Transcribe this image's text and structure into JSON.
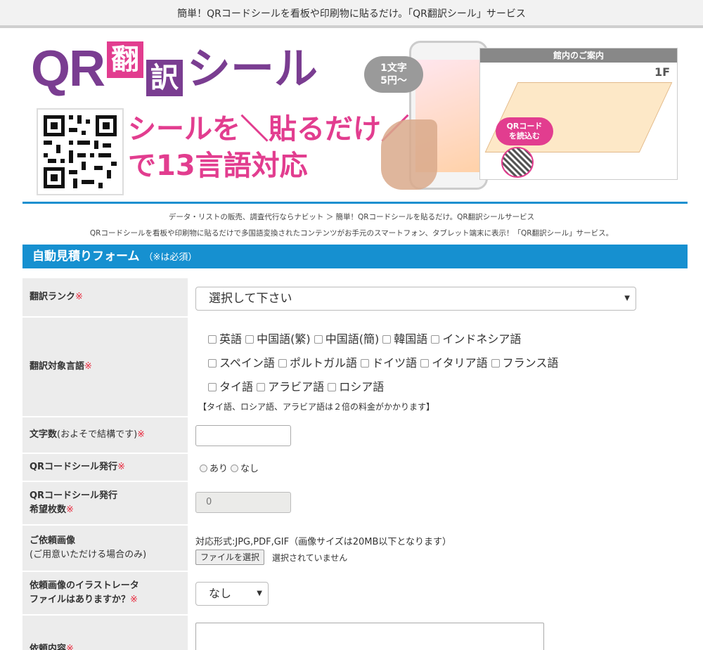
{
  "topbar": {
    "text": "簡単！QRコードシールを看板や印刷物に貼るだけ。「QR翻訳シール」サービス"
  },
  "banner": {
    "logo_qr": "QR",
    "logo_char1": "翻",
    "logo_char2": "訳",
    "logo_seal": "シール",
    "tagline_line1": "シールを＼貼るだけ／",
    "tagline_line2": "で13言語対応",
    "bubble_line1": "1文字",
    "bubble_line2": "5円～",
    "map_title": "館内のご案内",
    "map_floor": "1F",
    "map_badge_line1": "QRコード",
    "map_badge_line2": "を読込む"
  },
  "breadcrumb": "データ・リストの販売、調査代行ならナビット ＞ 簡単！QRコードシールを貼るだけ。QR翻訳シールサービス",
  "description": "QRコードシールを看板や印刷物に貼るだけで多国語変換されたコンテンツがお手元のスマートフォン、タブレット端末に表示！「QR翻訳シール」サービス。",
  "form": {
    "title": "自動見積りフォーム",
    "subtitle": "（※は必須）",
    "required_mark": "※",
    "rank": {
      "label": "翻訳ランク",
      "selected": "選択して下さい"
    },
    "languages": {
      "label": "翻訳対象言語",
      "row1": [
        "英語",
        "中国語(繁)",
        "中国語(簡)",
        "韓国語",
        "インドネシア語"
      ],
      "row2": [
        "スペイン語",
        "ポルトガル語",
        "ドイツ語",
        "イタリア語",
        "フランス語"
      ],
      "row3": [
        "タイ語",
        "アラビア語",
        "ロシア語"
      ],
      "note": "【タイ語、ロシア語、アラビア語は２倍の料金がかかります】"
    },
    "chars": {
      "label": "文字数",
      "label_note": "(およそで結構です)",
      "value": ""
    },
    "qr_issue": {
      "label": "QRコードシール発行",
      "options": [
        "あり",
        "なし"
      ]
    },
    "qr_count": {
      "label_line1": "QRコードシール発行",
      "label_line2": "希望枚数",
      "value": "0"
    },
    "image": {
      "label_line1": "ご依頼画像",
      "label_line2": "(ご用意いただける場合のみ)",
      "format_note": "対応形式:JPG,PDF,GIF（画像サイズは20MB以下となります）",
      "button": "ファイルを選択",
      "status": "選択されていません"
    },
    "illustrator": {
      "label_line1": "依頼画像のイラストレータ",
      "label_line2": "ファイルはありますか？",
      "selected": "なし"
    },
    "content": {
      "label": "依頼内容",
      "value": ""
    }
  }
}
